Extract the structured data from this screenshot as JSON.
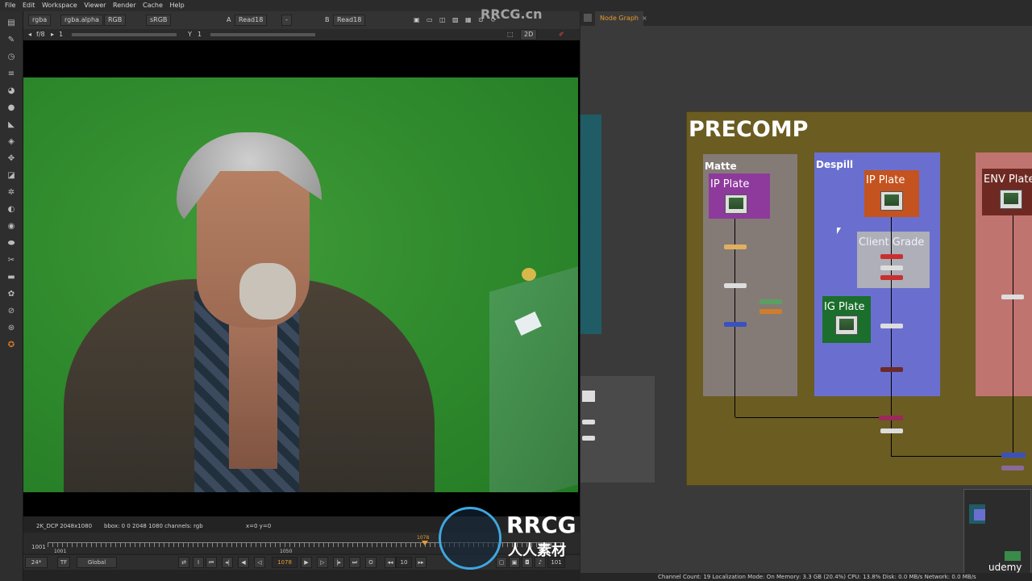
{
  "menubar": {
    "items": [
      "File",
      "Edit",
      "Workspace",
      "Viewer",
      "Render",
      "Cache",
      "Help"
    ]
  },
  "viewer": {
    "channels": "rgba",
    "alpha": "rgba.alpha",
    "mode": "RGB",
    "colorspace": "sRGB",
    "input_a_label": "A",
    "input_a": "Read18",
    "operation": "-",
    "input_b_label": "B",
    "input_b": "Read18",
    "view_mode": "2D",
    "gain": "f/8",
    "gain_value": "1",
    "y_label": "Y",
    "y_value": "1",
    "info_format": "2K_DCP 2048x1080",
    "info_bbox": "bbox: 0 0 2048 1080 channels: rgb",
    "info_xy": "x=0 y=0"
  },
  "timeline": {
    "in_frame": "1001",
    "in_frame2": "1001",
    "mid_frame": "1050",
    "current_marker": "1078",
    "fps": "24*",
    "tf": "TF",
    "scope": "Global",
    "current_frame": "1078",
    "step": "10",
    "out_frame": "101"
  },
  "nodegraph": {
    "tab": "Node Graph",
    "backdrop_title": "PRECOMP",
    "groups": {
      "matte": "Matte",
      "despill": "Despill"
    },
    "plates": {
      "matte_ip": "IP Plate",
      "despill_ip": "IP Plate",
      "client_grade": "Client Grade",
      "ig_plate": "IG Plate",
      "env_plate": "ENV Plate"
    },
    "colors": {
      "precomp": "#6b5c22",
      "matte": "#857b76",
      "despill": "#6a6fcf",
      "env": "#c07470",
      "matte_ip": "#8e3a9c",
      "despill_ip": "#c4531f",
      "client_grade": "#b6b6b6",
      "ig_plate": "#1b6e2c",
      "env_plate": "#6e2a22",
      "teal": "#1f5c66"
    }
  },
  "status": {
    "text": "Channel Count: 19  Localization Mode: On  Memory: 3.3 GB (20.4%)  CPU: 13.8%  Disk: 0.0 MB/s  Network: 0.0 MB/s"
  },
  "watermark": {
    "brand": "RRCG",
    "sub": "人人素材",
    "site": "RRCG.cn",
    "udemy": "udemy"
  }
}
